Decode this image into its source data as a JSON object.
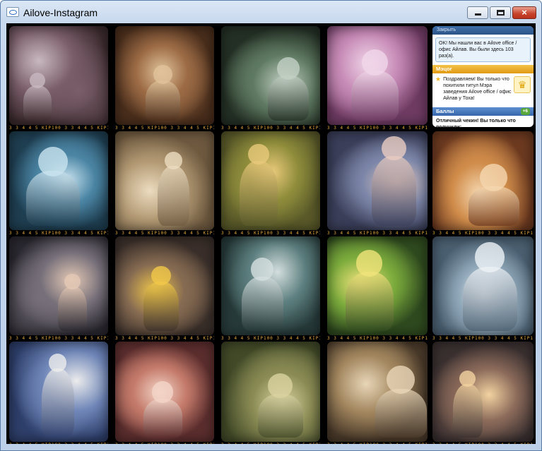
{
  "window": {
    "title": "Ailove-Instagram",
    "controls": {
      "minimize": "minimize",
      "maximize": "maximize",
      "close": "×"
    }
  },
  "notification": {
    "close_label": "Закрыть",
    "checkin_message": "OK! Мы нашли вас в Ailove office / офис Айлав. Вы были здесь 103 раз(а).",
    "mayor_header": "Мэцor",
    "mayor_message": "Поздравляем! Вы только что похитили титул Мэра заведения Ailove office / офис Айлав у Тоха!",
    "points_header": "Баллы",
    "points_badge": "+6",
    "points_message": "Отличный чекин! Вы только что получили:"
  },
  "film_strip_text": "3 3 4 4 5 KIP100 3 3 4 4 5 KIP100 4 4 5 KIP100",
  "photos": [
    {
      "colors": [
        "#3b2a2e",
        "#7a5e6a",
        "#c8b8c0"
      ]
    },
    {
      "colors": [
        "#4a2e1c",
        "#9c6b45",
        "#e0c29a"
      ]
    },
    {
      "colors": [
        "#243025",
        "#5f7a62",
        "#c2cfc4"
      ]
    },
    {
      "colors": [
        "#6f3b63",
        "#c78bb7",
        "#f0d6e8"
      ]
    },
    {
      "colors": [
        "#1f3f52",
        "#4b85a4",
        "#c9e3ef"
      ]
    },
    {
      "colors": [
        "#6f5a40",
        "#b39a74",
        "#ecdcc0"
      ]
    },
    {
      "colors": [
        "#5a5a2a",
        "#8f8d3b",
        "#e9c97a"
      ]
    },
    {
      "colors": [
        "#3b3f5a",
        "#7c86a8",
        "#e8ccc2"
      ]
    },
    {
      "colors": [
        "#6d3a20",
        "#d08c4a",
        "#f5d7b0"
      ]
    },
    {
      "colors": [
        "#2a2830",
        "#77707a",
        "#e3c8b5"
      ]
    },
    {
      "colors": [
        "#3a2f2a",
        "#866b52",
        "#f1c84a"
      ]
    },
    {
      "colors": [
        "#273a3a",
        "#5d7f7f",
        "#d4dede"
      ]
    },
    {
      "colors": [
        "#2f4a1f",
        "#7bab3c",
        "#f0e37b"
      ]
    },
    {
      "colors": [
        "#4a5f70",
        "#8fa7b8",
        "#eef2f6"
      ]
    },
    {
      "colors": [
        "#2e3f6b",
        "#6f86b8",
        "#ececec"
      ]
    },
    {
      "colors": [
        "#5c2e2e",
        "#c47a6a",
        "#f3d5c8"
      ]
    },
    {
      "colors": [
        "#424a28",
        "#8a8b54",
        "#d9d2a0"
      ]
    },
    {
      "colors": [
        "#4a3a2a",
        "#a2865e",
        "#e8d6b8"
      ]
    },
    {
      "colors": [
        "#3a3030",
        "#8b6a5a",
        "#f2d2a0"
      ]
    }
  ]
}
